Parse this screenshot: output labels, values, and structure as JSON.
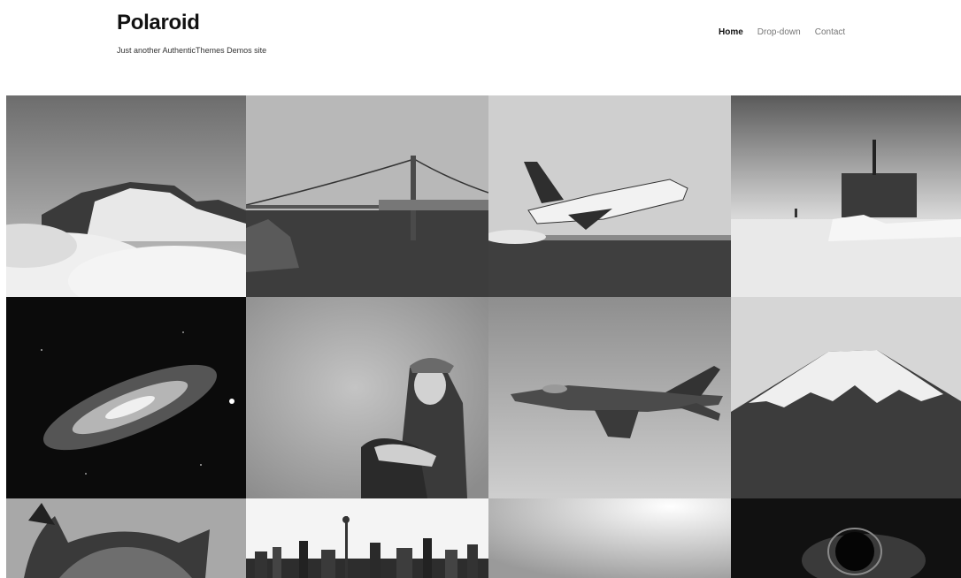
{
  "site": {
    "title": "Polaroid",
    "tagline": "Just another AuthenticThemes Demos site"
  },
  "nav": {
    "items": [
      {
        "label": "Home",
        "active": true
      },
      {
        "label": "Drop-down",
        "active": false
      },
      {
        "label": "Contact",
        "active": false
      }
    ]
  },
  "gallery": {
    "tiles": [
      {
        "icon": "mountain-clouds-photo"
      },
      {
        "icon": "bridge-photo"
      },
      {
        "icon": "space-shuttle-photo"
      },
      {
        "icon": "submarine-photo"
      },
      {
        "icon": "galaxy-photo"
      },
      {
        "icon": "woman-portrait-photo"
      },
      {
        "icon": "fighter-jet-photo"
      },
      {
        "icon": "mount-fuji-photo"
      },
      {
        "icon": "owl-photo"
      },
      {
        "icon": "city-skyline-photo"
      },
      {
        "icon": "bright-sky-photo"
      },
      {
        "icon": "eclipse-photo"
      }
    ]
  }
}
